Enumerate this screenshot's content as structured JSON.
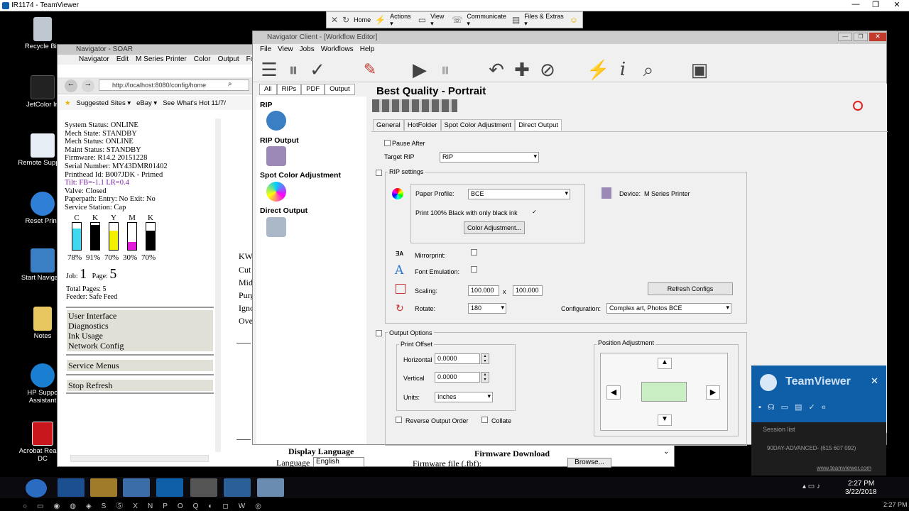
{
  "teamviewer": {
    "window_title": "IR1174 - TeamViewer",
    "toolbar": {
      "home": "Home",
      "actions": "Actions ▾",
      "view": "View ▾",
      "communicate": "Communicate ▾",
      "files": "Files & Extras ▾"
    }
  },
  "desktop_icons": {
    "recycle": "Recycle Bin",
    "jetcolor": "JetColor In",
    "remote": "Remote Support",
    "reset": "Reset Printi",
    "start_nav": "Start Navigato",
    "notes": "Notes",
    "hp_support": "HP Suppo Assistant",
    "acrobat": "Acrobat Reader DC"
  },
  "soar": {
    "title": "Navigator - SOAR",
    "menu": [
      "Navigator",
      "Edit",
      "M Series Printer",
      "Color",
      "Output",
      "Fonts"
    ],
    "url": "http://localhost:8080/config/home",
    "favorites": [
      "Suggested Sites ▾",
      "eBay ▾",
      "See What's Hot 11/7/"
    ],
    "status_lines": [
      "System Status: ONLINE",
      "Mech State: STANDBY",
      "Mech Status: ONLINE",
      "Maint Status: STANDBY",
      "Firmware: R14.2 20151228",
      "Serial Number: MY43DMR01402",
      "Printhead Id: B007JDK - Primed",
      "Tilt: FB=-1.1 LR=0.4",
      "Valve: Closed",
      "Paperpath: Entry: No Exit: No",
      "Service Station: Cap"
    ],
    "inks": [
      {
        "label": "C",
        "level": 0.78,
        "pct": "78%",
        "color": "#40d8ef"
      },
      {
        "label": "K",
        "level": 0.91,
        "pct": "91%",
        "color": "#000000"
      },
      {
        "label": "Y",
        "level": 0.7,
        "pct": "70%",
        "color": "#f2f200"
      },
      {
        "label": "M",
        "level": 0.3,
        "pct": "30%",
        "color": "#e21bd8"
      },
      {
        "label": "K",
        "level": 0.7,
        "pct": "70%",
        "color": "#000000"
      }
    ],
    "job_label": "Job:",
    "job_value": "1",
    "page_label": "Page:",
    "page_value": "5",
    "total_pages": "Total Pages: 5",
    "feeder": "Feeder: Safe Feed",
    "menu_links": [
      "User Interface",
      "Diagnostics",
      "Ink Usage",
      "Network Config"
    ],
    "service_menus": "Service Menus",
    "stop_refresh": "Stop Refresh",
    "right_fragments": [
      "KW",
      "Cut",
      "Mid",
      "Purg",
      "Igno",
      "Ove"
    ],
    "display_language": "Display Language",
    "language_label": "Language",
    "language_value": "English",
    "firmware_download": "Firmware Download",
    "firmware_file": "Firmware file (.fbf):",
    "browse": "Browse..."
  },
  "nc": {
    "title": "Navigator Client - [Workflow Editor]",
    "menu": [
      "File",
      "View",
      "Jobs",
      "Workflows",
      "Help"
    ],
    "left_tabs": [
      "All",
      "RIPs",
      "PDF",
      "Output"
    ],
    "left_items": [
      "RIP",
      "RIP Output",
      "Spot Color Adjustment",
      "Direct Output"
    ],
    "workflow_title": "Best Quality - Portrait",
    "tabs": [
      "General",
      "HotFolder",
      "Spot Color Adjustment",
      "Direct Output"
    ],
    "pause_after": "Pause After",
    "target_rip_label": "Target RIP",
    "target_rip_value": "RIP",
    "rip_settings": "RIP settings",
    "paper_profile_label": "Paper Profile:",
    "paper_profile_value": "BCE",
    "print_black": "Print 100% Black with only black ink",
    "color_adjustment": "Color Adjustment...",
    "device_label": "Device:",
    "device_value": "M Series Printer",
    "mirrorprint": "Mirrorprint:",
    "font_emulation": "Font Emulation:",
    "scaling": "Scaling:",
    "scale_x": "100.000",
    "scale_sep": "x",
    "scale_y": "100.000",
    "refresh_configs": "Refresh Configs",
    "rotate": "Rotate:",
    "rotate_value": "180",
    "configuration": "Configuration:",
    "configuration_value": "Complex art, Photos BCE",
    "output_options": "Output Options",
    "print_offset": "Print Offset",
    "horizontal": "Horizontal",
    "horizontal_value": "0.0000",
    "vertical": "Vertical",
    "vertical_value": "0.0000",
    "units": "Units:",
    "units_value": "Inches",
    "position_adjustment": "Position Adjustment",
    "reverse_output": "Reverse Output Order",
    "collate": "Collate"
  },
  "tvpanel": {
    "brand": "TeamViewer",
    "session_list": "Session list",
    "session": "90DAY-ADVANCED- (615 607 092)",
    "url": "www.teamviewer.com"
  },
  "taskbar": {
    "time": "2:27 PM",
    "date": "3/22/2018",
    "outer_time": "2:27 PM"
  }
}
